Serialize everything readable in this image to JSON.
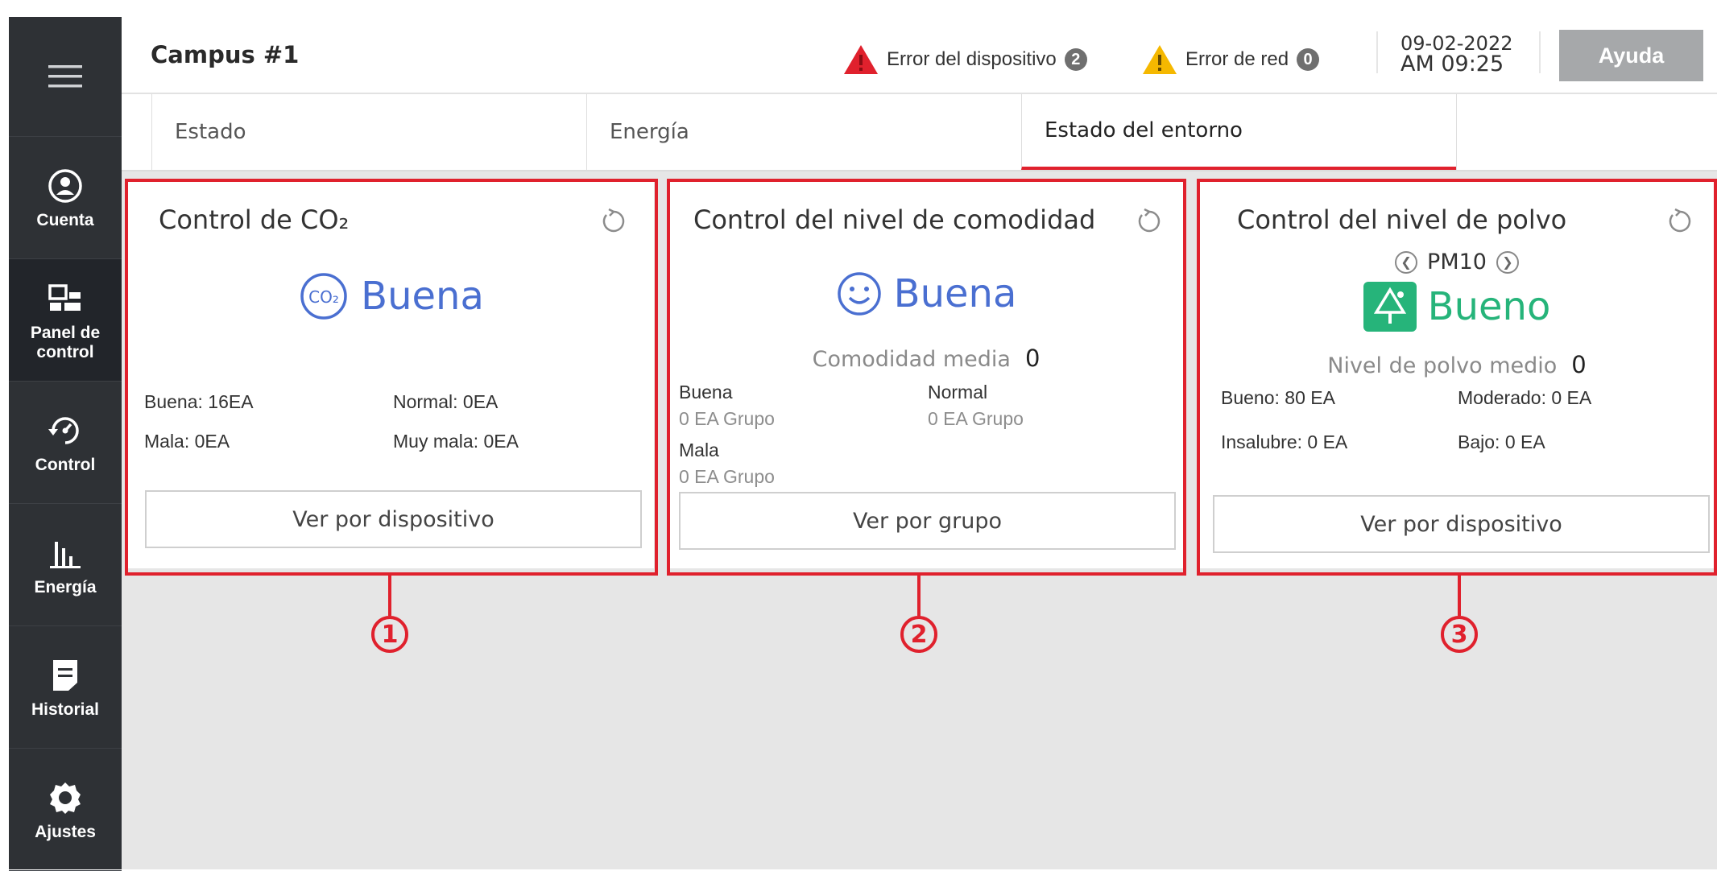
{
  "sidebar": {
    "items": [
      {
        "label": "Cuenta",
        "icon": "user-icon"
      },
      {
        "label": "Panel de control",
        "label_line1": "Panel de",
        "label_line2": "control",
        "icon": "dashboard-icon",
        "active": true
      },
      {
        "label": "Control",
        "icon": "control-icon"
      },
      {
        "label": "Energía",
        "icon": "energy-icon"
      },
      {
        "label": "Historial",
        "icon": "history-icon"
      },
      {
        "label": "Ajustes",
        "icon": "settings-icon"
      }
    ]
  },
  "header": {
    "title": "Campus #1",
    "device_error_label": "Error del dispositivo",
    "device_error_count": "2",
    "network_error_label": "Error de red",
    "network_error_count": "0",
    "date": "09-02-2022",
    "time": "AM 09:25",
    "help_label": "Ayuda"
  },
  "tabs": [
    {
      "label": "Estado"
    },
    {
      "label": "Energía"
    },
    {
      "label": "Estado del entorno",
      "active": true
    }
  ],
  "cards": {
    "co2": {
      "title": "Control de CO₂",
      "icon_text": "CO₂",
      "status": "Buena",
      "stats": [
        "Buena: 16EA",
        "Normal: 0EA",
        "Mala: 0EA",
        "Muy mala: 0EA"
      ],
      "button": "Ver por dispositivo",
      "callout": "1"
    },
    "comfort": {
      "title": "Control del nivel de comodidad",
      "status": "Buena",
      "avg_label": "Comodidad media",
      "avg_value": "0",
      "groups": [
        {
          "label": "Buena",
          "value": "0 EA Grupo"
        },
        {
          "label": "Normal",
          "value": "0 EA Grupo"
        },
        {
          "label": "Mala",
          "value": "0 EA Grupo"
        }
      ],
      "button": "Ver por grupo",
      "callout": "2"
    },
    "dust": {
      "title": "Control del nivel de polvo",
      "pm": "PM10",
      "status": "Bueno",
      "avg_label": "Nivel de polvo medio",
      "avg_value": "0",
      "stats": [
        "Bueno: 80 EA",
        "Moderado: 0 EA",
        "Insalubre: 0 EA",
        "Bajo: 0 EA"
      ],
      "button": "Ver por dispositivo",
      "callout": "3"
    }
  },
  "colors": {
    "accent": "#e0212d",
    "status_blue": "#4a6fd1",
    "status_green": "#26b47a",
    "sidebar": "#2e3135"
  }
}
